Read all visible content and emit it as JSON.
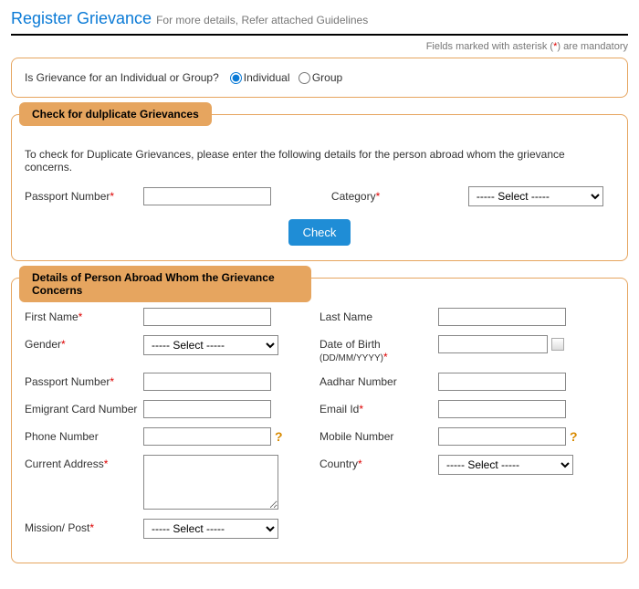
{
  "header": {
    "title": "Register Grievance",
    "subtitle": "For more details, Refer attached Guidelines",
    "mandatory_pre": "Fields marked with asterisk (",
    "mandatory_star": "*",
    "mandatory_post": ") are mandatory"
  },
  "panel1": {
    "question": "Is Grievance for an Individual or Group?",
    "opt_individual": "Individual",
    "opt_group": "Group"
  },
  "panel2": {
    "legend": "Check for dulplicate Grievances",
    "helptext": "To check for Duplicate Grievances, please enter the following details for the person abroad whom the grievance concerns.",
    "passport_label": "Passport Number",
    "category_label": "Category",
    "select_placeholder": "----- Select -----",
    "check_btn": "Check"
  },
  "panel3": {
    "legend": "Details of Person Abroad Whom the Grievance Concerns",
    "first_name": "First Name",
    "last_name": "Last Name",
    "gender": "Gender",
    "dob_pre": "Date of Birth ",
    "dob_fmt": "(DD/MM/YYYY)",
    "passport": "Passport Number",
    "aadhar": "Aadhar Number",
    "emigrant": "Emigrant Card Number",
    "email": "Email Id",
    "phone": "Phone Number",
    "mobile": "Mobile Number",
    "address": "Current Address",
    "country": "Country",
    "mission": "Mission/ Post",
    "select_placeholder": "----- Select -----"
  }
}
